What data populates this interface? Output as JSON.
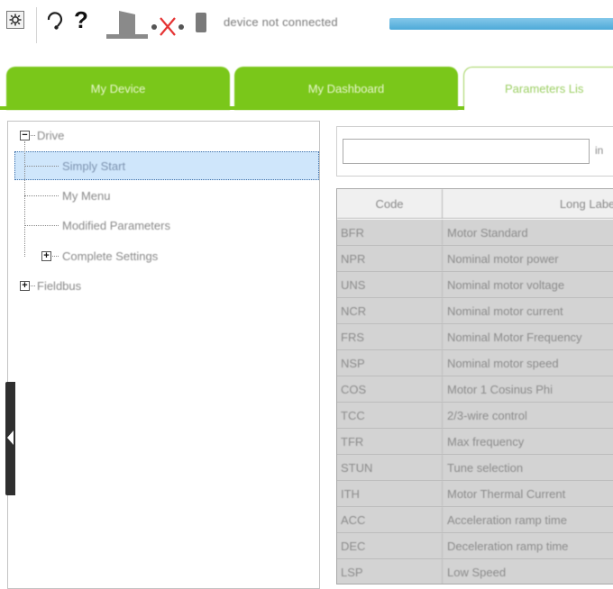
{
  "toolbar": {
    "settings_icon": "settings-window-icon",
    "help_ring_icon": "headset-icon",
    "help_label": "?",
    "device_icon": "drive-device-icon",
    "disconnect_icon": "disconnected-x-icon",
    "plug_icon": "plug-icon",
    "status_text": "device not connected",
    "accent_color": "#4ea9d8"
  },
  "tabs": [
    {
      "label": "My Device"
    },
    {
      "label": "My Dashboard"
    },
    {
      "label": "Parameters Lis"
    }
  ],
  "colors": {
    "tab_green": "#7ac71a",
    "selection": "#cfe6fb"
  },
  "tree": {
    "root": "Drive",
    "items": [
      "Simply Start",
      "My Menu",
      "Modified Parameters",
      "Complete Settings"
    ],
    "fieldbus": "Fieldbus",
    "root_toggle": "−",
    "complete_toggle": "+",
    "fieldbus_toggle": "+"
  },
  "search": {
    "value": "",
    "placeholder": "",
    "in_label": "in"
  },
  "grid": {
    "columns": [
      "Code",
      "Long Label"
    ],
    "rows": [
      [
        "BFR",
        "Motor Standard"
      ],
      [
        "NPR",
        "Nominal motor power"
      ],
      [
        "UNS",
        "Nominal motor voltage"
      ],
      [
        "NCR",
        "Nominal motor current"
      ],
      [
        "FRS",
        "Nominal Motor Frequency"
      ],
      [
        "NSP",
        "Nominal motor speed"
      ],
      [
        "COS",
        "Motor 1 Cosinus Phi"
      ],
      [
        "TCC",
        "2/3-wire control"
      ],
      [
        "TFR",
        "Max frequency"
      ],
      [
        "STUN",
        "Tune selection"
      ],
      [
        "ITH",
        "Motor Thermal Current"
      ],
      [
        "ACC",
        "Acceleration ramp time"
      ],
      [
        "DEC",
        "Deceleration ramp time"
      ],
      [
        "LSP",
        "Low Speed"
      ]
    ]
  }
}
